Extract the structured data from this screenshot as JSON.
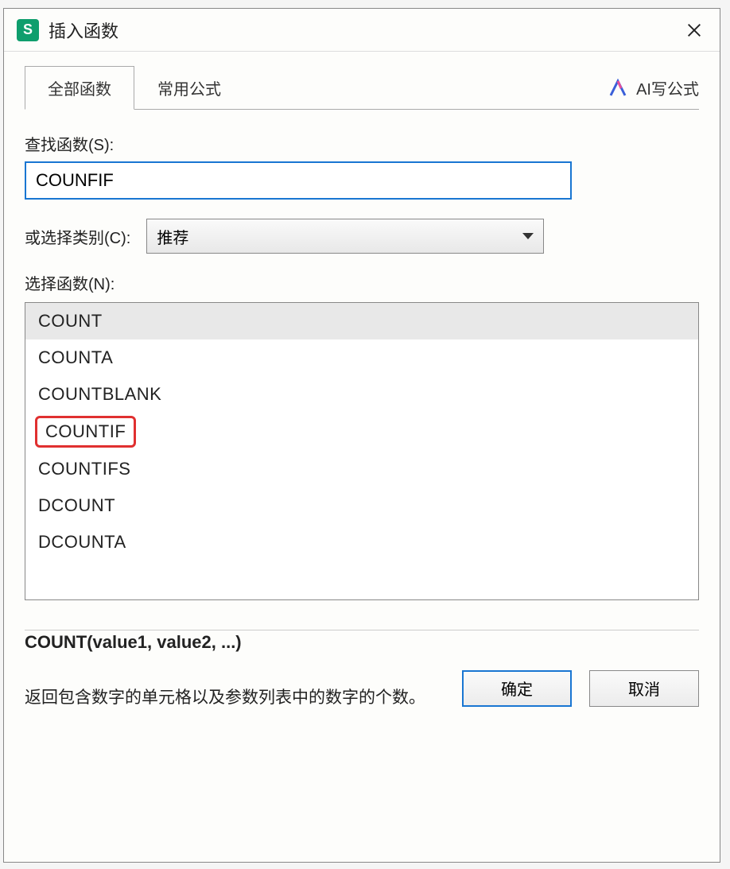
{
  "dialog": {
    "title": "插入函数",
    "app_icon_letter": "S"
  },
  "tabs": {
    "all_functions": "全部函数",
    "common_formulas": "常用公式",
    "ai_formula": "AI写公式"
  },
  "search": {
    "label": "查找函数(S):",
    "value": "COUNFIF"
  },
  "category": {
    "label": "或选择类别(C):",
    "selected": "推荐"
  },
  "function_list": {
    "label": "选择函数(N):",
    "items": [
      "COUNT",
      "COUNTA",
      "COUNTBLANK",
      "COUNTIF",
      "COUNTIFS",
      "DCOUNT",
      "DCOUNTA"
    ]
  },
  "syntax": "COUNT(value1, value2, ...)",
  "description": "返回包含数字的单元格以及参数列表中的数字的个数。",
  "buttons": {
    "ok": "确定",
    "cancel": "取消"
  }
}
